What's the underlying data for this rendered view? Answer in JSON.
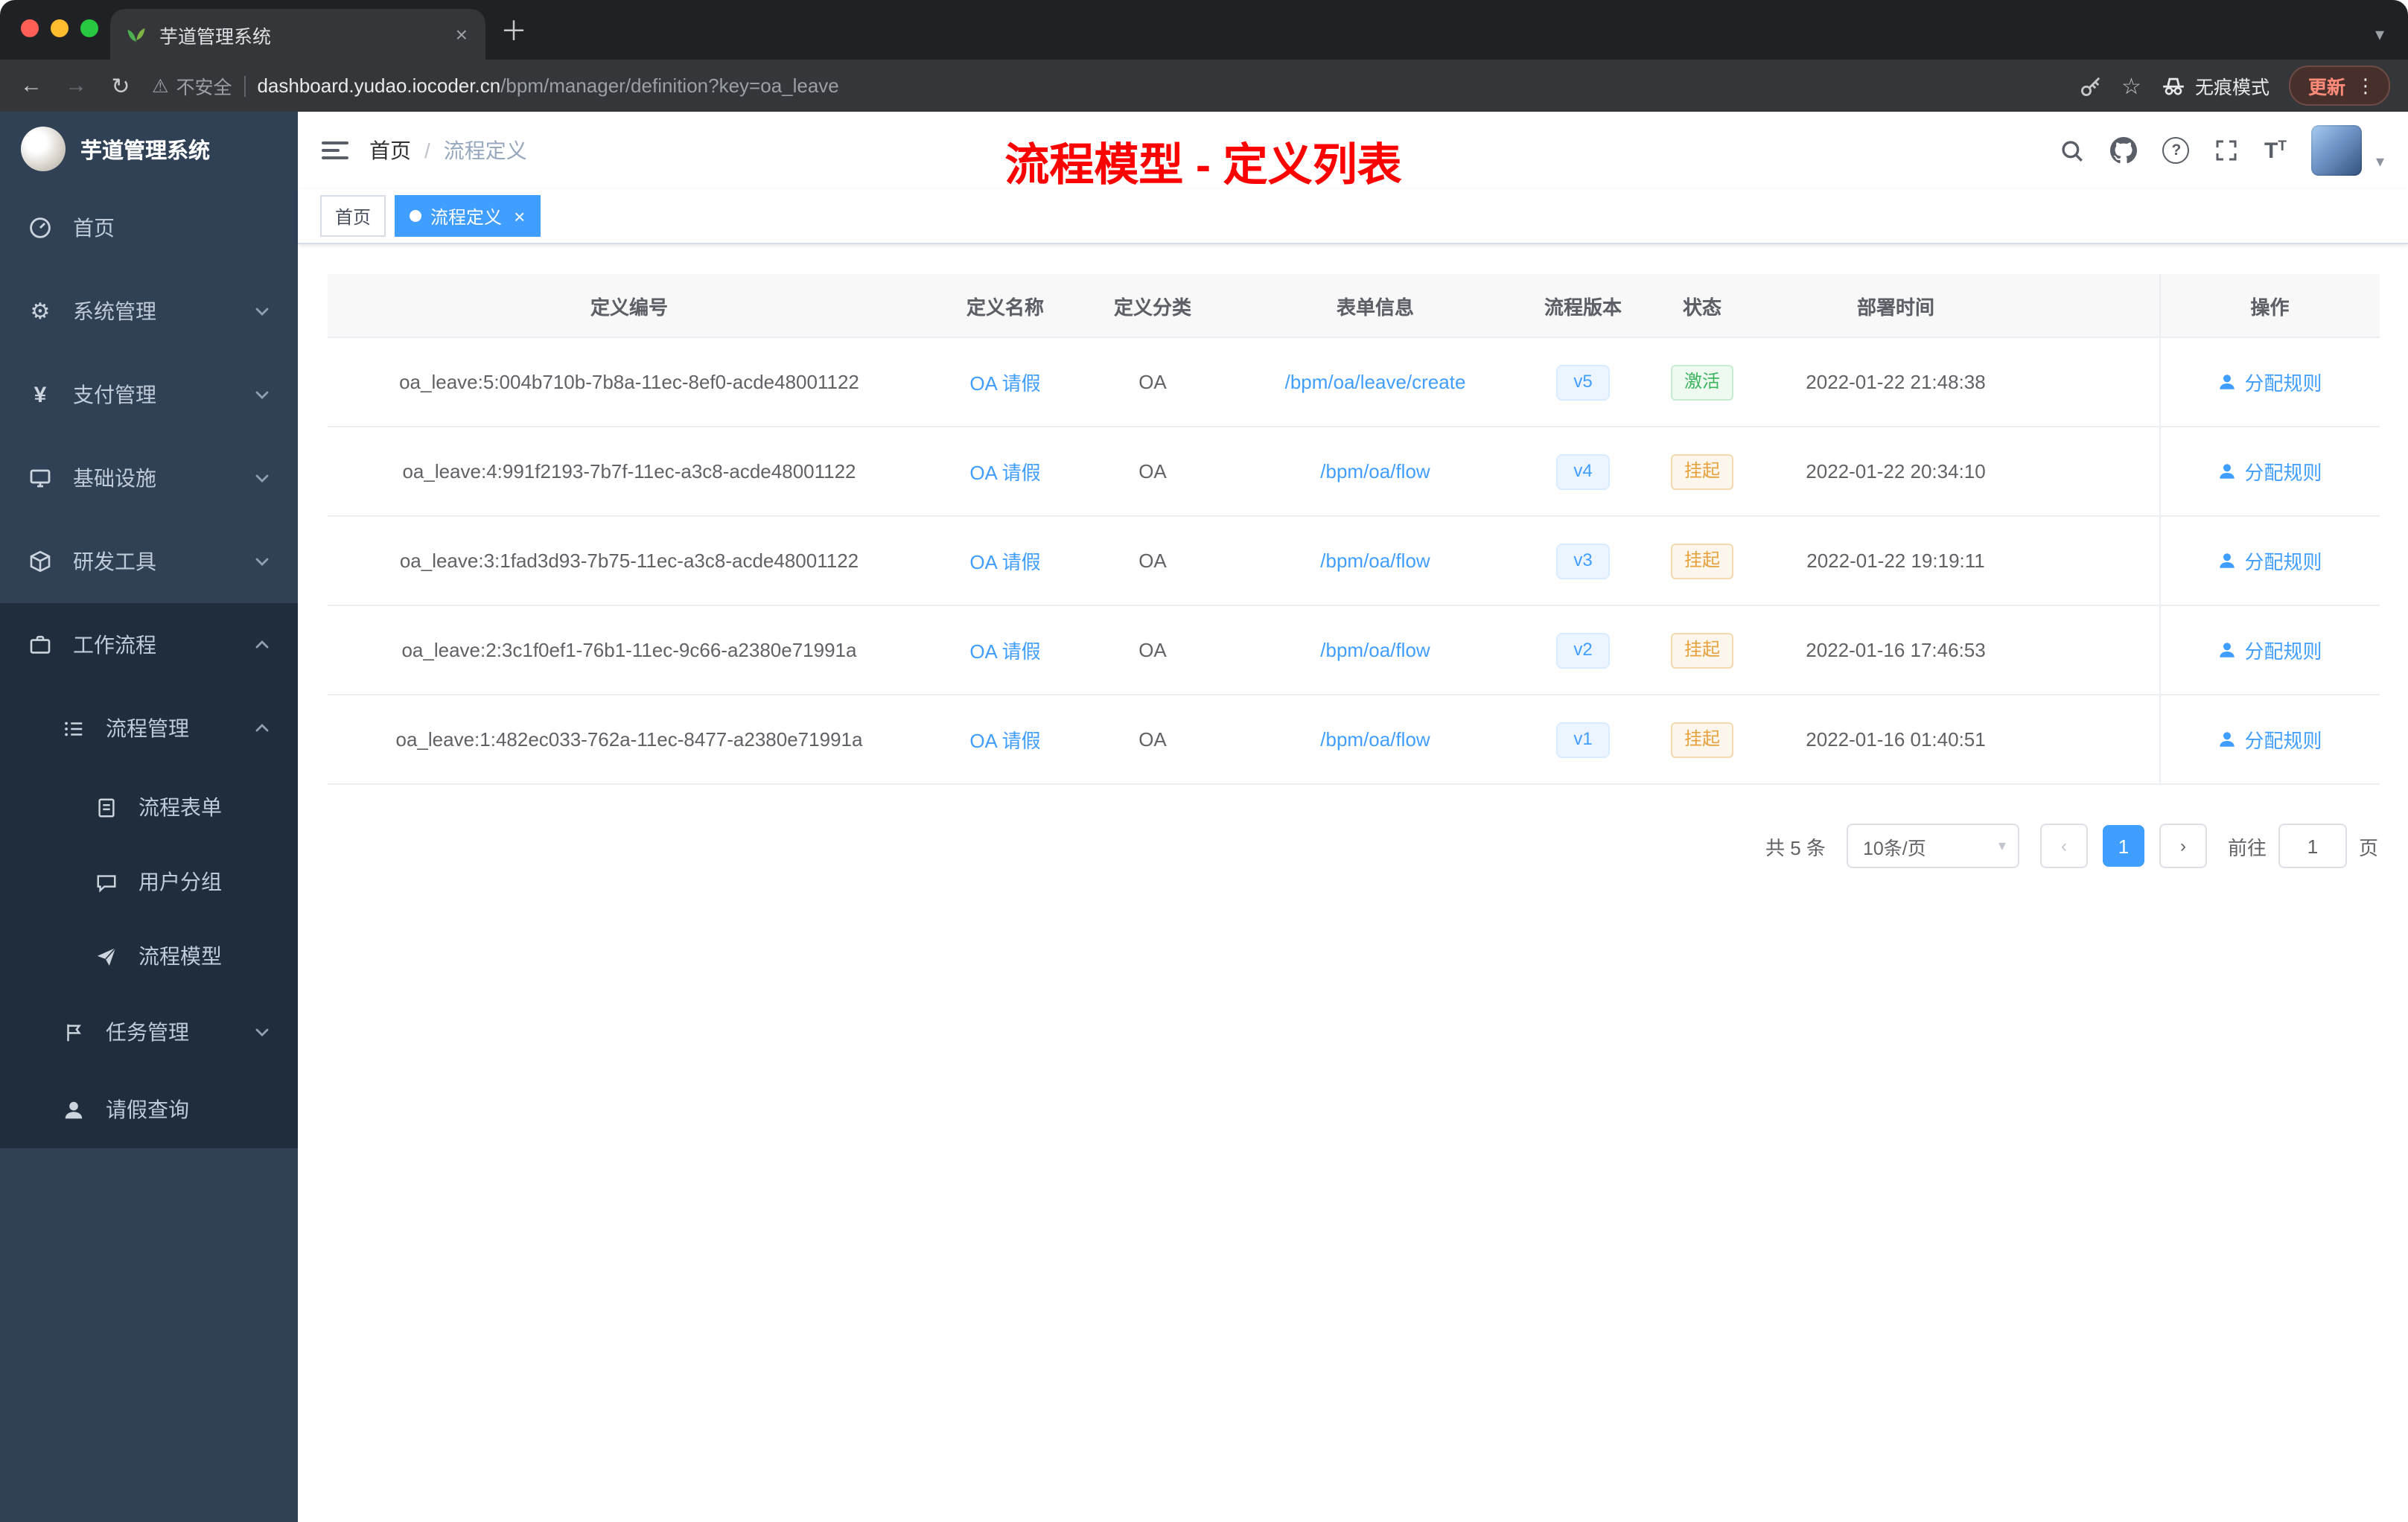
{
  "browser": {
    "tab_title": "芋道管理系统",
    "security": "不安全",
    "host": "dashboard.yudao.iocoder.cn",
    "path": "/bpm/manager/definition?key=oa_leave",
    "incognito": "无痕模式",
    "update": "更新"
  },
  "icons": {
    "back": "←",
    "forward": "→",
    "reload": "↻",
    "warning": "⚠",
    "star": "☆",
    "kebab": "⋮",
    "close": "×",
    "plus": "＋",
    "caret_down": "▾",
    "gear": "⚙",
    "yen": "¥",
    "question": "?",
    "font_big": "T",
    "font_small": "T",
    "chev_left": "‹",
    "chev_right": "›"
  },
  "sidebar": {
    "brand": "芋道管理系统",
    "menu": [
      {
        "label": "首页"
      },
      {
        "label": "系统管理"
      },
      {
        "label": "支付管理"
      },
      {
        "label": "基础设施"
      },
      {
        "label": "研发工具"
      },
      {
        "label": "工作流程"
      }
    ],
    "sub": [
      {
        "label": "流程管理"
      },
      {
        "label": "流程表单"
      },
      {
        "label": "用户分组"
      },
      {
        "label": "流程模型"
      },
      {
        "label": "任务管理"
      },
      {
        "label": "请假查询"
      }
    ]
  },
  "header": {
    "breadcrumb": {
      "home": "首页",
      "current": "流程定义"
    },
    "overlay_title": "流程模型 - 定义列表"
  },
  "tags": {
    "home": "首页",
    "active": "流程定义"
  },
  "table": {
    "columns": [
      "定义编号",
      "定义名称",
      "定义分类",
      "表单信息",
      "流程版本",
      "状态",
      "部署时间",
      "操作"
    ],
    "rows": [
      {
        "id": "oa_leave:5:004b710b-7b8a-11ec-8ef0-acde48001122",
        "name": "OA 请假",
        "category": "OA",
        "form": "/bpm/oa/leave/create",
        "version": "v5",
        "status": "激活",
        "deployed": "2022-01-22 21:48:38",
        "action": "分配规则"
      },
      {
        "id": "oa_leave:4:991f2193-7b7f-11ec-a3c8-acde48001122",
        "name": "OA 请假",
        "category": "OA",
        "form": "/bpm/oa/flow",
        "version": "v4",
        "status": "挂起",
        "deployed": "2022-01-22 20:34:10",
        "action": "分配规则"
      },
      {
        "id": "oa_leave:3:1fad3d93-7b75-11ec-a3c8-acde48001122",
        "name": "OA 请假",
        "category": "OA",
        "form": "/bpm/oa/flow",
        "version": "v3",
        "status": "挂起",
        "deployed": "2022-01-22 19:19:11",
        "action": "分配规则"
      },
      {
        "id": "oa_leave:2:3c1f0ef1-76b1-11ec-9c66-a2380e71991a",
        "name": "OA 请假",
        "category": "OA",
        "form": "/bpm/oa/flow",
        "version": "v2",
        "status": "挂起",
        "deployed": "2022-01-16 17:46:53",
        "action": "分配规则"
      },
      {
        "id": "oa_leave:1:482ec033-762a-11ec-8477-a2380e71991a",
        "name": "OA 请假",
        "category": "OA",
        "form": "/bpm/oa/flow",
        "version": "v1",
        "status": "挂起",
        "deployed": "2022-01-16 01:40:51",
        "action": "分配规则"
      }
    ]
  },
  "pagination": {
    "total": "共 5 条",
    "page_size": "10条/页",
    "page": "1",
    "goto_label": "前往",
    "goto_value": "1",
    "page_unit": "页"
  },
  "colors": {
    "accent": "#409eff",
    "success": "#67c23a",
    "warning": "#e6a23c",
    "annotation_red": "#fd0000",
    "sidebar_bg": "#304156",
    "submenu_bg": "#1f2d3d"
  }
}
